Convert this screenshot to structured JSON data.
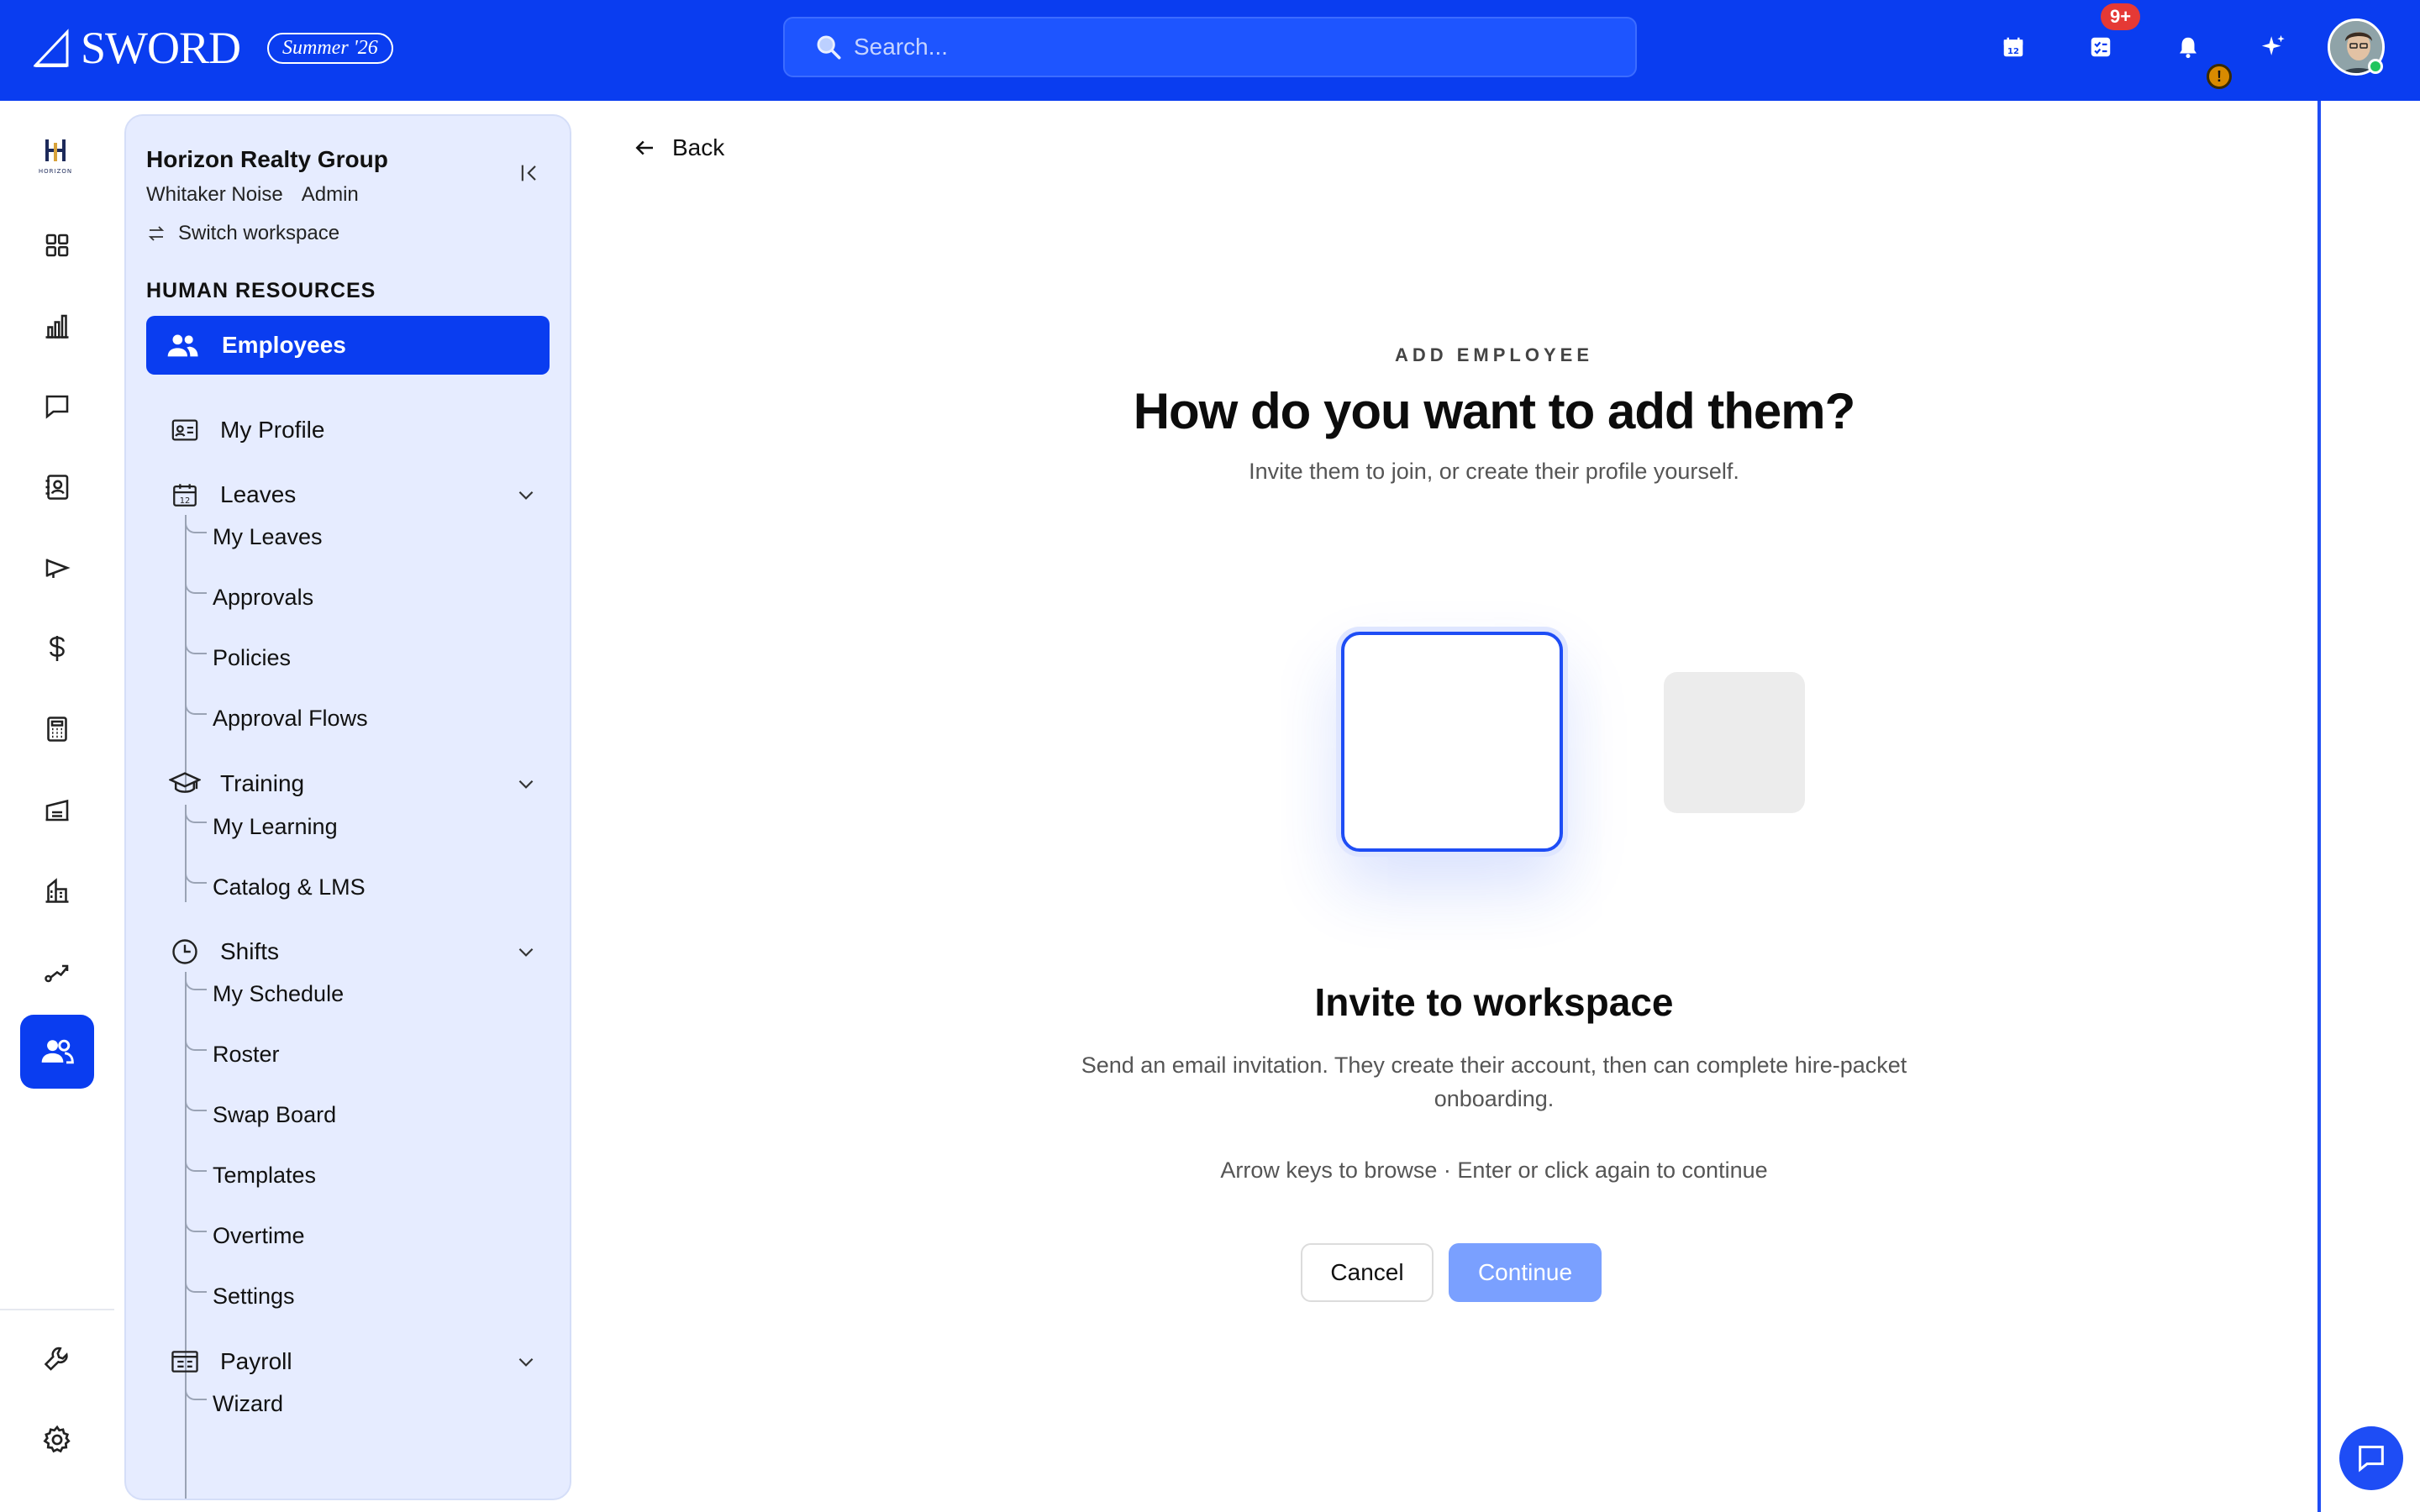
{
  "brand": {
    "name": "SWORD",
    "badge": "Summer '26"
  },
  "search": {
    "placeholder": "Search..."
  },
  "topbar": {
    "tasks_badge": "9+",
    "alert_badge": "!"
  },
  "sidebar": {
    "org_name": "Horizon Realty Group",
    "user_name": "Whitaker Noise",
    "user_role": "Admin",
    "switch_label": "Switch workspace",
    "section": "HUMAN RESOURCES",
    "active_item": "Employees",
    "items": {
      "my_profile": "My Profile",
      "leaves": "Leaves",
      "training": "Training",
      "shifts": "Shifts",
      "payroll": "Payroll"
    },
    "leaves_sub": [
      "My Leaves",
      "Approvals",
      "Policies",
      "Approval Flows"
    ],
    "training_sub": [
      "My Learning",
      "Catalog & LMS"
    ],
    "shifts_sub": [
      "My Schedule",
      "Roster",
      "Swap Board",
      "Templates",
      "Overtime",
      "Settings"
    ],
    "payroll_sub": [
      "Wizard"
    ]
  },
  "main": {
    "back_label": "Back",
    "eyebrow": "ADD EMPLOYEE",
    "title": "How do you want to add them?",
    "subtitle": "Invite them to join, or create their profile yourself.",
    "option_title": "Invite to workspace",
    "option_desc": "Send an email invitation. They create their account, then can complete hire-packet onboarding.",
    "hint": "Arrow keys to browse · Enter or click again to continue",
    "cancel_label": "Cancel",
    "continue_label": "Continue"
  },
  "colors": {
    "brand_blue": "#0a3df0",
    "sidebar_bg": "#e6ecff",
    "continue_disabled": "#7aa0ff"
  }
}
